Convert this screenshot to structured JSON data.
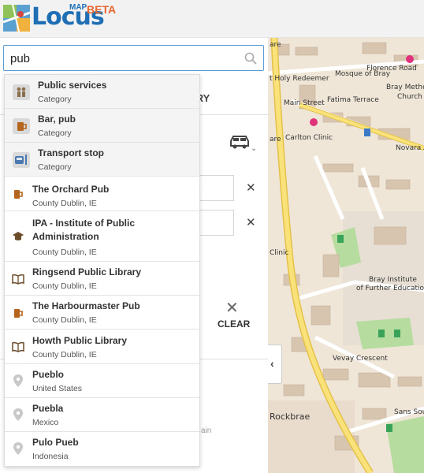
{
  "header": {
    "brand": "Locus",
    "brand_map": "MAP",
    "brand_beta": "BETA"
  },
  "search": {
    "value": "pub"
  },
  "background": {
    "tab_label": "RARY",
    "clear_label": "CLEAR",
    "remove_symbol": "✕",
    "truncated_text": "ain"
  },
  "suggestions": [
    {
      "kind": "category",
      "icon": "people-icon",
      "title": "Public services",
      "subtitle": "Category"
    },
    {
      "kind": "category",
      "icon": "beer-mug-icon",
      "title": "Bar, pub",
      "subtitle": "Category"
    },
    {
      "kind": "category",
      "icon": "bus-stop-icon",
      "title": "Transport stop",
      "subtitle": "Category"
    },
    {
      "kind": "place",
      "icon": "beer-mug-icon",
      "title": "The Orchard Pub",
      "subtitle": "County Dublin, IE"
    },
    {
      "kind": "place",
      "icon": "graduation-cap-icon",
      "title": "IPA - Institute of Public Administration",
      "subtitle": "County Dublin, IE"
    },
    {
      "kind": "place",
      "icon": "book-icon",
      "title": "Ringsend Public Library",
      "subtitle": "County Dublin, IE"
    },
    {
      "kind": "place",
      "icon": "beer-mug-icon",
      "title": "The Harbourmaster Pub",
      "subtitle": "County Dublin, IE"
    },
    {
      "kind": "place",
      "icon": "book-icon",
      "title": "Howth Public Library",
      "subtitle": "County Dublin, IE"
    },
    {
      "kind": "place",
      "icon": "map-pin-icon",
      "title": "Pueblo",
      "subtitle": "United States"
    },
    {
      "kind": "place",
      "icon": "map-pin-icon",
      "title": "Puebla",
      "subtitle": "Mexico"
    },
    {
      "kind": "place",
      "icon": "map-pin-icon",
      "title": "Pulo Pueb",
      "subtitle": "Indonesia"
    }
  ],
  "map": {
    "labels": [
      "Florence Road",
      "t Holy Redeemer",
      "Mosque of Bray",
      "Bray Metho",
      "Church",
      "Fatima Terrace",
      "Carlton Clinic",
      "Novara A",
      "Clinic",
      "Bray Institute",
      "of Further Educatio",
      "Vevay Crescent",
      "Rockbrae",
      "Sans Souci",
      "Main Street",
      "are",
      "are"
    ],
    "toggle_symbol": "‹"
  }
}
